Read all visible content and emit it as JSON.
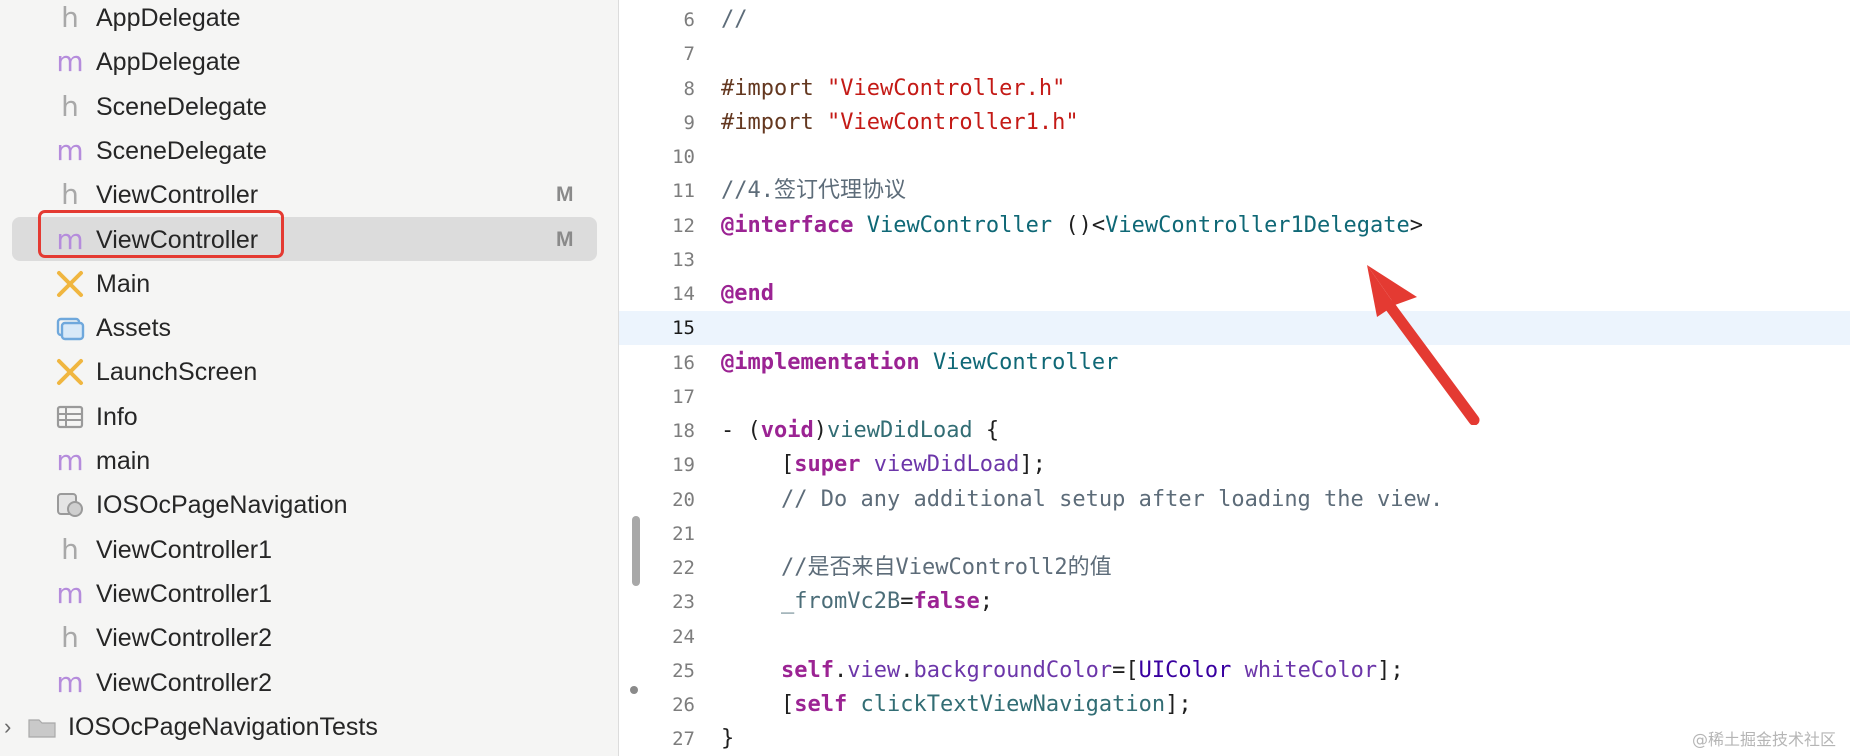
{
  "navigator": {
    "items": [
      {
        "icon": "h",
        "label": "AppDelegate",
        "badge": ""
      },
      {
        "icon": "m",
        "label": "AppDelegate",
        "badge": ""
      },
      {
        "icon": "h",
        "label": "SceneDelegate",
        "badge": ""
      },
      {
        "icon": "m",
        "label": "SceneDelegate",
        "badge": ""
      },
      {
        "icon": "h",
        "label": "ViewController",
        "badge": "M"
      },
      {
        "icon": "m",
        "label": "ViewController",
        "badge": "M"
      },
      {
        "icon": "storyboard",
        "label": "Main",
        "badge": ""
      },
      {
        "icon": "assets",
        "label": "Assets",
        "badge": ""
      },
      {
        "icon": "storyboard",
        "label": "LaunchScreen",
        "badge": ""
      },
      {
        "icon": "plist",
        "label": "Info",
        "badge": ""
      },
      {
        "icon": "m",
        "label": "main",
        "badge": ""
      },
      {
        "icon": "entitlements",
        "label": "IOSOcPageNavigation",
        "badge": ""
      },
      {
        "icon": "h",
        "label": "ViewController1",
        "badge": ""
      },
      {
        "icon": "m",
        "label": "ViewController1",
        "badge": ""
      },
      {
        "icon": "h",
        "label": "ViewController2",
        "badge": ""
      },
      {
        "icon": "m",
        "label": "ViewController2",
        "badge": ""
      },
      {
        "icon": "folder",
        "label": "IOSOcPageNavigationTests",
        "badge": ""
      }
    ],
    "icon_glyphs": {
      "h": "h",
      "m": "m"
    },
    "chevron": "›"
  },
  "editor": {
    "current_line": "15",
    "lines": [
      {
        "num": "6",
        "tokens": [
          [
            "//",
            "comment"
          ]
        ]
      },
      {
        "num": "7",
        "tokens": []
      },
      {
        "num": "8",
        "tokens": [
          [
            "#import ",
            "pre"
          ],
          [
            "\"ViewController.h\"",
            "str"
          ]
        ]
      },
      {
        "num": "9",
        "tokens": [
          [
            "#import ",
            "pre"
          ],
          [
            "\"ViewController1.h\"",
            "str"
          ]
        ]
      },
      {
        "num": "10",
        "tokens": []
      },
      {
        "num": "11",
        "tokens": [
          [
            "//4.签订代理协议",
            "comment"
          ]
        ]
      },
      {
        "num": "12",
        "tokens": [
          [
            "@interface",
            "kw"
          ],
          [
            " ",
            "plain"
          ],
          [
            "ViewController",
            "type"
          ],
          [
            " ()<",
            "plain"
          ],
          [
            "ViewController1Delegate",
            "type"
          ],
          [
            ">",
            "plain"
          ]
        ]
      },
      {
        "num": "13",
        "tokens": []
      },
      {
        "num": "14",
        "tokens": [
          [
            "@end",
            "kw"
          ]
        ]
      },
      {
        "num": "15",
        "tokens": []
      },
      {
        "num": "16",
        "tokens": [
          [
            "@implementation",
            "kw"
          ],
          [
            " ",
            "plain"
          ],
          [
            "ViewController",
            "type"
          ]
        ]
      },
      {
        "num": "17",
        "tokens": []
      },
      {
        "num": "18",
        "tokens": [
          [
            "- (",
            "plain"
          ],
          [
            "void",
            "kw"
          ],
          [
            ")",
            "plain"
          ],
          [
            "viewDidLoad",
            "fn"
          ],
          [
            " {",
            "plain"
          ]
        ]
      },
      {
        "num": "19",
        "indent": true,
        "tokens": [
          [
            "[",
            "plain"
          ],
          [
            "super",
            "kw"
          ],
          [
            " ",
            "plain"
          ],
          [
            "viewDidLoad",
            "prop"
          ],
          [
            "];",
            "plain"
          ]
        ]
      },
      {
        "num": "20",
        "indent": true,
        "tokens": [
          [
            "// Do any additional setup after loading the view.",
            "comment"
          ]
        ]
      },
      {
        "num": "21",
        "tokens": []
      },
      {
        "num": "22",
        "indent": true,
        "tokens": [
          [
            "//是否来自ViewControll2的值",
            "comment"
          ]
        ]
      },
      {
        "num": "23",
        "indent": true,
        "tokens": [
          [
            "_fromVc2B",
            "ivar"
          ],
          [
            "=",
            "plain"
          ],
          [
            "false",
            "kw"
          ],
          [
            ";",
            "plain"
          ]
        ]
      },
      {
        "num": "24",
        "tokens": []
      },
      {
        "num": "25",
        "indent": true,
        "tokens": [
          [
            "self",
            "kw"
          ],
          [
            ".",
            "plain"
          ],
          [
            "view",
            "prop"
          ],
          [
            ".",
            "plain"
          ],
          [
            "backgroundColor",
            "prop"
          ],
          [
            "=[",
            "plain"
          ],
          [
            "UIColor",
            "cls"
          ],
          [
            " ",
            "plain"
          ],
          [
            "whiteColor",
            "prop"
          ],
          [
            "];",
            "plain"
          ]
        ]
      },
      {
        "num": "26",
        "indent": true,
        "tokens": [
          [
            "[",
            "plain"
          ],
          [
            "self",
            "kw"
          ],
          [
            " ",
            "plain"
          ],
          [
            "clickTextViewNavigation",
            "fn"
          ],
          [
            "];",
            "plain"
          ]
        ]
      },
      {
        "num": "27",
        "tokens": [
          [
            "}",
            "plain"
          ]
        ]
      }
    ]
  },
  "watermark": "@稀土掘金技术社区",
  "colors": {
    "annotation_red": "#e43a32",
    "selection": "#dcdcdc",
    "current_line": "#ecf4fd"
  }
}
